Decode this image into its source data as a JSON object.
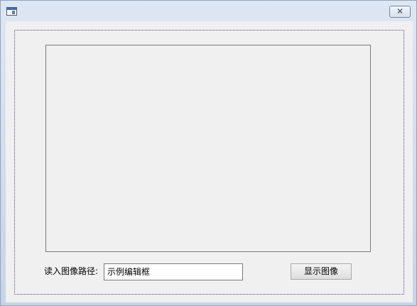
{
  "window": {
    "icon": "app-icon",
    "close_label": "✕"
  },
  "form": {
    "path_label": "读入图像路径:",
    "path_input_value": "示例编辑框",
    "show_button_label": "显示图像"
  }
}
